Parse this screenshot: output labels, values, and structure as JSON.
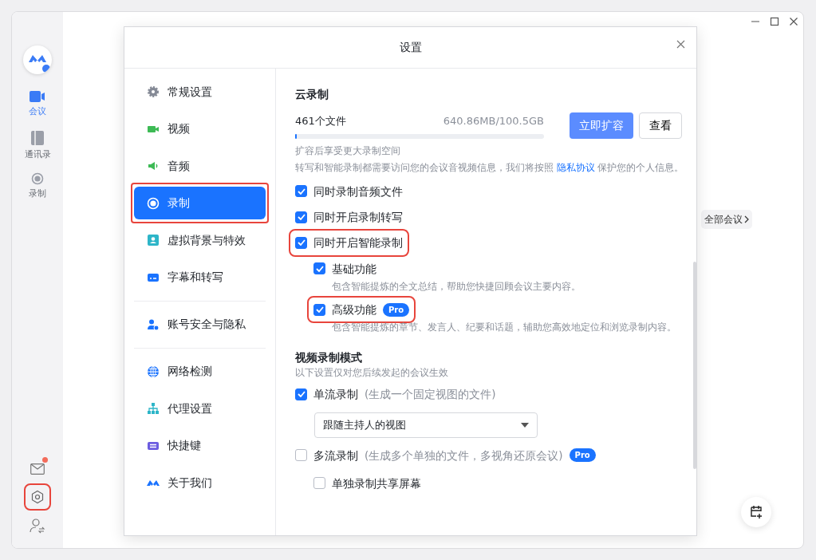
{
  "rail": {
    "items": [
      {
        "label": "会议",
        "kind": "camera",
        "selected": true
      },
      {
        "label": "通讯录",
        "kind": "book",
        "selected": false
      },
      {
        "label": "录制",
        "kind": "record",
        "selected": false
      }
    ],
    "mail_unread": true,
    "settings_highlighted": true
  },
  "background": {
    "all_meetings_link": "全部会议"
  },
  "dialog": {
    "title": "设置",
    "nav_groups": [
      {
        "items": [
          {
            "label": "常规设置",
            "kind": "gear",
            "selected": false,
            "highlighted": false
          },
          {
            "label": "视频",
            "kind": "video",
            "selected": false,
            "highlighted": false
          },
          {
            "label": "音频",
            "kind": "speaker",
            "selected": false,
            "highlighted": false
          },
          {
            "label": "录制",
            "kind": "record",
            "selected": true,
            "highlighted": true
          },
          {
            "label": "虚拟背景与特效",
            "kind": "portrait",
            "selected": false,
            "highlighted": false
          },
          {
            "label": "字幕和转写",
            "kind": "subtitles",
            "selected": false,
            "highlighted": false
          }
        ]
      },
      {
        "items": [
          {
            "label": "账号安全与隐私",
            "kind": "user-shield",
            "selected": false,
            "highlighted": false
          }
        ]
      },
      {
        "items": [
          {
            "label": "网络检测",
            "kind": "globe",
            "selected": false,
            "highlighted": false
          },
          {
            "label": "代理设置",
            "kind": "network",
            "selected": false,
            "highlighted": false
          },
          {
            "label": "快捷键",
            "kind": "keyboard",
            "selected": false,
            "highlighted": false
          },
          {
            "label": "关于我们",
            "kind": "logo",
            "selected": false,
            "highlighted": false
          }
        ]
      }
    ],
    "cloud": {
      "title": "云录制",
      "files": "461个文件",
      "usage": "640.86MB/100.5GB",
      "level": 0.006,
      "hint": "扩容后享受更大录制空间",
      "expand_button": "立即扩容",
      "view_button": "查看",
      "notice_before": "转写和智能录制都需要访问您的会议音视频信息，我们将按照",
      "notice_link": "隐私协议",
      "notice_after": "保护您的个人信息。",
      "options": [
        {
          "label": "同时录制音频文件",
          "checked": true,
          "highlighted": false
        },
        {
          "label": "同时开启录制转写",
          "checked": true,
          "highlighted": false
        },
        {
          "label": "同时开启智能录制",
          "checked": true,
          "highlighted": true,
          "children": [
            {
              "label": "基础功能",
              "checked": true,
              "highlighted": false,
              "description": "包含智能提炼的全文总结，帮助您快捷回顾会议主要内容。"
            },
            {
              "label": "高级功能",
              "badge": "Pro",
              "checked": true,
              "highlighted": true,
              "description": "包含智能提炼的章节、发言人、纪要和话题，辅助您高效地定位和浏览录制内容。"
            }
          ]
        }
      ]
    },
    "video_mode": {
      "title": "视频录制模式",
      "subtitle": "以下设置仅对您后续发起的会议生效",
      "options": [
        {
          "label": "单流录制",
          "note": "(生成一个固定视图的文件)",
          "checked": true,
          "select_value": "跟随主持人的视图"
        },
        {
          "label": "多流录制",
          "note": "(生成多个单独的文件，多视角还原会议)",
          "badge": "Pro",
          "checked": false,
          "children": [
            {
              "label": "单独录制共享屏幕",
              "checked": false
            }
          ]
        }
      ]
    }
  }
}
